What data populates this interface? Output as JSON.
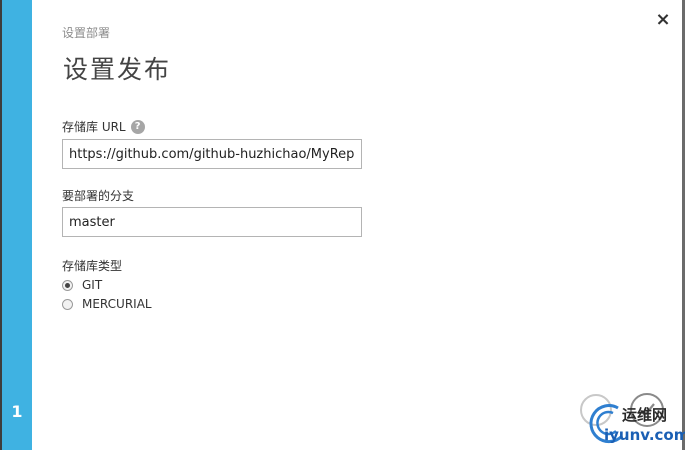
{
  "wizard": {
    "step_number": "1",
    "close_glyph": "×",
    "subtitle": "设置部署",
    "title": "设置发布"
  },
  "form": {
    "repo_url": {
      "label": "存储库 URL",
      "help_glyph": "?",
      "value": "https://github.com/github-huzhichao/MyReposito"
    },
    "branch": {
      "label": "要部署的分支",
      "value": "master"
    },
    "repo_type": {
      "label": "存储库类型",
      "options": [
        {
          "label": "GIT",
          "selected": true
        },
        {
          "label": "MERCURIAL",
          "selected": false
        }
      ]
    }
  },
  "icons": {
    "close": "close-icon",
    "help": "help-icon",
    "confirm": "checkmark-icon"
  },
  "colors": {
    "accent": "#3fb2e2"
  },
  "watermark": {
    "line1": "运维网",
    "line2": "iyunv.com"
  }
}
